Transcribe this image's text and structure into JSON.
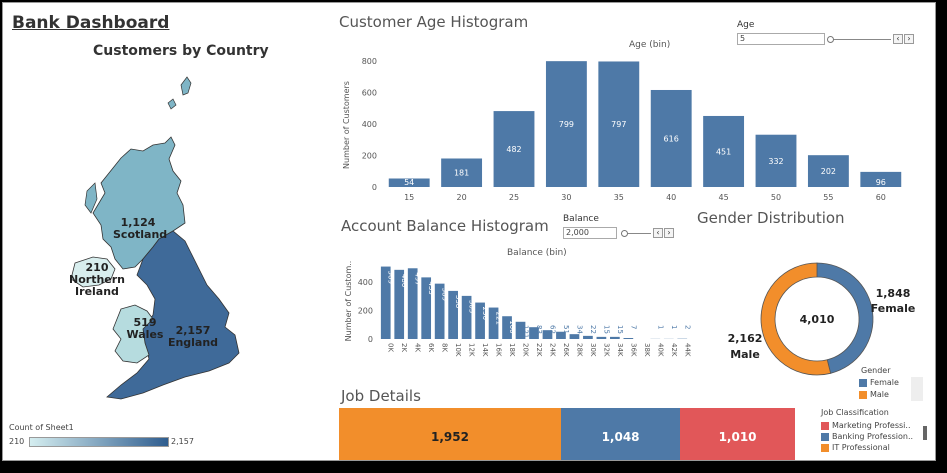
{
  "dashboard_title": "Bank Dashboard",
  "map": {
    "title": "Customers by Country",
    "regions": [
      {
        "name": "Scotland",
        "value": "1,124",
        "color": "#7fb5c6"
      },
      {
        "name": "Northern Ireland",
        "value": "210",
        "color": "#d8eeee"
      },
      {
        "name": "Wales",
        "value": "519",
        "color": "#b6dcdf"
      },
      {
        "name": "England",
        "value": "2,157",
        "color": "#3f6a99"
      }
    ],
    "legend": {
      "title": "Count of Sheet1",
      "min": "210",
      "max": "2,157",
      "color_min": "#d5eef0",
      "color_max": "#2f5d8f"
    }
  },
  "age_param": {
    "label": "Age",
    "value": "5"
  },
  "balance_param": {
    "label": "Balance",
    "value": "2,000"
  },
  "stepper": {
    "prev": "‹",
    "next": "›"
  },
  "job": {
    "title": "Job Details",
    "segments": [
      {
        "label": "1,952",
        "value": 1952,
        "color": "#f28e2b"
      },
      {
        "label": "1,048",
        "value": 1048,
        "color": "#4e79a7"
      },
      {
        "label": "1,010",
        "value": 1010,
        "color": "#e15759"
      }
    ],
    "legend_title": "Job Classification",
    "legend_items": [
      {
        "label": "Marketing Professi..",
        "color": "#e15759"
      },
      {
        "label": "Banking Profession..",
        "color": "#4e79a7"
      },
      {
        "label": "IT Professional",
        "color": "#f28e2b"
      }
    ]
  },
  "chart_data": [
    {
      "type": "bar",
      "title": "Customer Age Histogram",
      "subtitle": "Age (bin)",
      "ylabel": "Number of Customers",
      "categories": [
        "15",
        "20",
        "25",
        "30",
        "35",
        "40",
        "45",
        "50",
        "55",
        "60"
      ],
      "values": [
        54,
        181,
        482,
        799,
        797,
        616,
        451,
        332,
        202,
        96
      ],
      "yticks": [
        "0",
        "200",
        "400",
        "600",
        "800"
      ],
      "ylim": [
        0,
        800
      ],
      "color": "#4e79a7",
      "grid": false
    },
    {
      "type": "bar",
      "title": "Account Balance Histogram",
      "subtitle": "Balance (bin)",
      "ylabel": "Number of Custom..",
      "categories": [
        "0K",
        "2K",
        "4K",
        "6K",
        "8K",
        "10K",
        "12K",
        "14K",
        "16K",
        "18K",
        "20K",
        "22K",
        "24K",
        "26K",
        "28K",
        "30K",
        "32K",
        "34K",
        "36K",
        "38K",
        "40K",
        "42K",
        "44K"
      ],
      "values": [
        509,
        486,
        497,
        433,
        389,
        338,
        303,
        256,
        221,
        160,
        121,
        83,
        62,
        51,
        34,
        22,
        15,
        15,
        7,
        0,
        1,
        1,
        2
      ],
      "labels": [
        "509",
        "486",
        "497",
        "433",
        "389",
        "338",
        "303",
        "256",
        "221",
        "160",
        "121",
        "83",
        "62",
        "51",
        "34",
        "22",
        "15",
        "15",
        "7",
        "",
        "1",
        "1",
        "2"
      ],
      "yticks": [
        "0",
        "200",
        "400"
      ],
      "ylim": [
        0,
        520
      ],
      "color": "#4e79a7",
      "grid": false
    },
    {
      "type": "pie",
      "title": "Gender Distribution",
      "center_label": "4,010",
      "slices": [
        {
          "name": "Female",
          "value": 1848,
          "label": "1,848",
          "color": "#4e79a7"
        },
        {
          "name": "Male",
          "value": 2162,
          "label": "2,162",
          "color": "#f28e2b"
        }
      ],
      "legend_title": "Gender",
      "legend_placement": "bottom-right"
    }
  ]
}
